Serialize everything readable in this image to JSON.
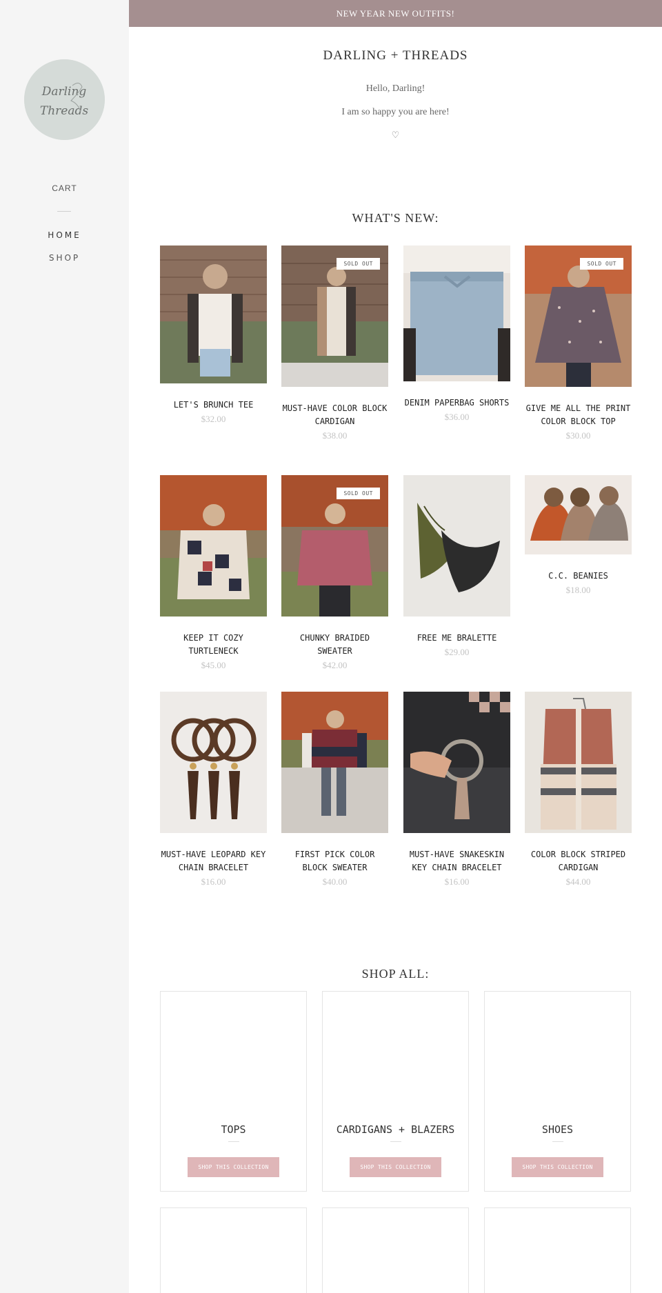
{
  "announcement": "NEW YEAR NEW OUTFITS!",
  "sidebar": {
    "logo_line1": "Darling",
    "logo_line2": "Threads",
    "cart": "CART",
    "home": "HOME",
    "shop": "SHOP"
  },
  "header": {
    "brand": "DARLING + THREADS",
    "greeting1": "Hello, Darling!",
    "greeting2": "I am so happy you are here!",
    "heart": "♡"
  },
  "whats_new": {
    "title": "WHAT'S NEW:",
    "sold_out_label": "SOLD OUT",
    "products": [
      {
        "name": "LET'S BRUNCH TEE",
        "price": "$32.00",
        "sold_out": false
      },
      {
        "name": "MUST-HAVE COLOR BLOCK CARDIGAN",
        "price": "$38.00",
        "sold_out": true
      },
      {
        "name": "DENIM PAPERBAG SHORTS",
        "price": "$36.00",
        "sold_out": false
      },
      {
        "name": "GIVE ME ALL THE PRINT COLOR BLOCK TOP",
        "price": "$30.00",
        "sold_out": true
      },
      {
        "name": "KEEP IT COZY TURTLENECK",
        "price": "$45.00",
        "sold_out": false
      },
      {
        "name": "CHUNKY BRAIDED SWEATER",
        "price": "$42.00",
        "sold_out": true
      },
      {
        "name": "FREE ME BRALETTE",
        "price": "$29.00",
        "sold_out": false
      },
      {
        "name": "C.C. BEANIES",
        "price": "$18.00",
        "sold_out": false
      },
      {
        "name": "MUST-HAVE LEOPARD KEY CHAIN BRACELET",
        "price": "$16.00",
        "sold_out": false
      },
      {
        "name": "FIRST PICK COLOR BLOCK SWEATER",
        "price": "$40.00",
        "sold_out": false
      },
      {
        "name": "MUST-HAVE SNAKESKIN KEY CHAIN BRACELET",
        "price": "$16.00",
        "sold_out": false
      },
      {
        "name": "COLOR BLOCK STRIPED CARDIGAN",
        "price": "$44.00",
        "sold_out": false
      }
    ]
  },
  "shop_all": {
    "title": "SHOP ALL:",
    "button_label": "SHOP THIS COLLECTION",
    "collections": [
      {
        "name": "TOPS"
      },
      {
        "name": "CARDIGANS + BLAZERS"
      },
      {
        "name": "SHOES"
      }
    ]
  },
  "colors": {
    "announcement_bg": "#a58f90",
    "sidebar_bg": "#f5f5f5",
    "button_bg": "#dfb6b8",
    "price": "#c4c4c4"
  }
}
